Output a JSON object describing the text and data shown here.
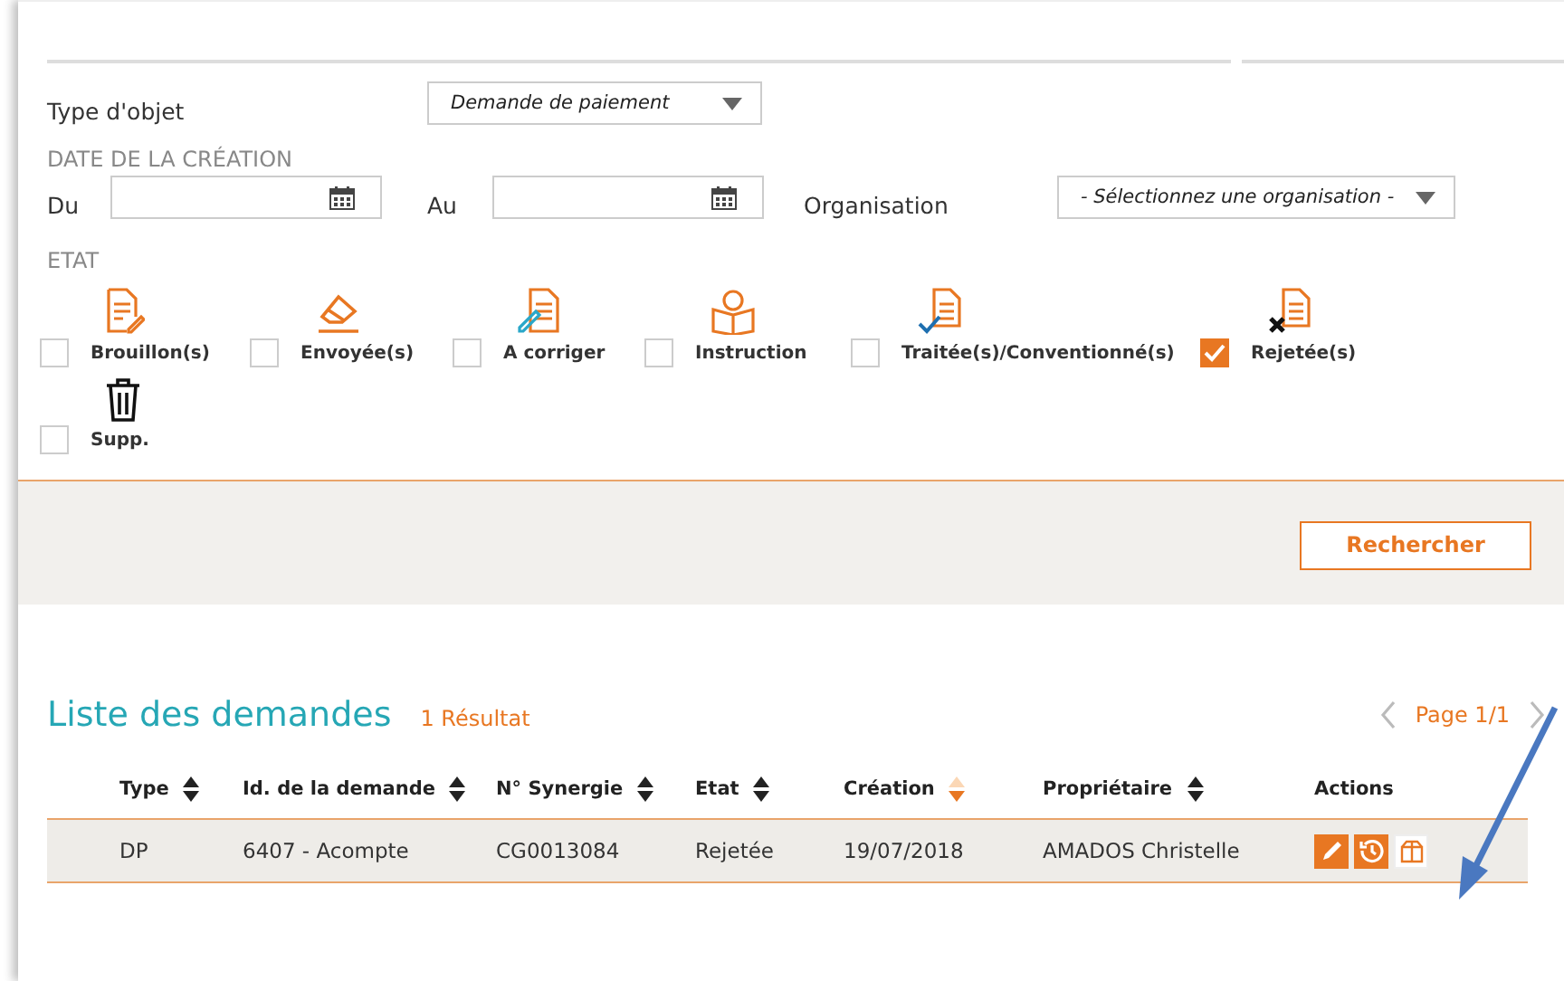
{
  "filters": {
    "object_type": {
      "label": "Type d'objet",
      "value": "Demande de paiement"
    },
    "creation_date": {
      "heading": "DATE DE LA CRÉATION",
      "from_label": "Du",
      "to_label": "Au"
    },
    "organisation": {
      "label": "Organisation",
      "value": "- Sélectionnez une organisation -"
    },
    "state": {
      "heading": "ETAT",
      "options": [
        {
          "label": "Brouillon(s)",
          "checked": false
        },
        {
          "label": "Envoyée(s)",
          "checked": false
        },
        {
          "label": "A corriger",
          "checked": false
        },
        {
          "label": "Instruction",
          "checked": false
        },
        {
          "label": "Traitée(s)/Conventionné(s)",
          "checked": false
        },
        {
          "label": "Rejetée(s)",
          "checked": true
        },
        {
          "label": "Supp.",
          "checked": false
        }
      ]
    }
  },
  "search_button": "Rechercher",
  "results": {
    "title": "Liste des demandes",
    "count": "1 Résultat",
    "page": "Page 1/1",
    "columns": [
      {
        "label": "Type",
        "sorted": false
      },
      {
        "label": "Id. de la demande",
        "sorted": false
      },
      {
        "label": "N° Synergie",
        "sorted": false
      },
      {
        "label": "Etat",
        "sorted": false
      },
      {
        "label": "Création",
        "sorted": true
      },
      {
        "label": "Propriétaire",
        "sorted": false
      },
      {
        "label": "Actions"
      }
    ],
    "rows": [
      {
        "cells": [
          "DP",
          "6407 - Acompte",
          "CG0013084",
          "Rejetée",
          "19/07/2018",
          "AMADOS  Christelle"
        ]
      }
    ]
  }
}
